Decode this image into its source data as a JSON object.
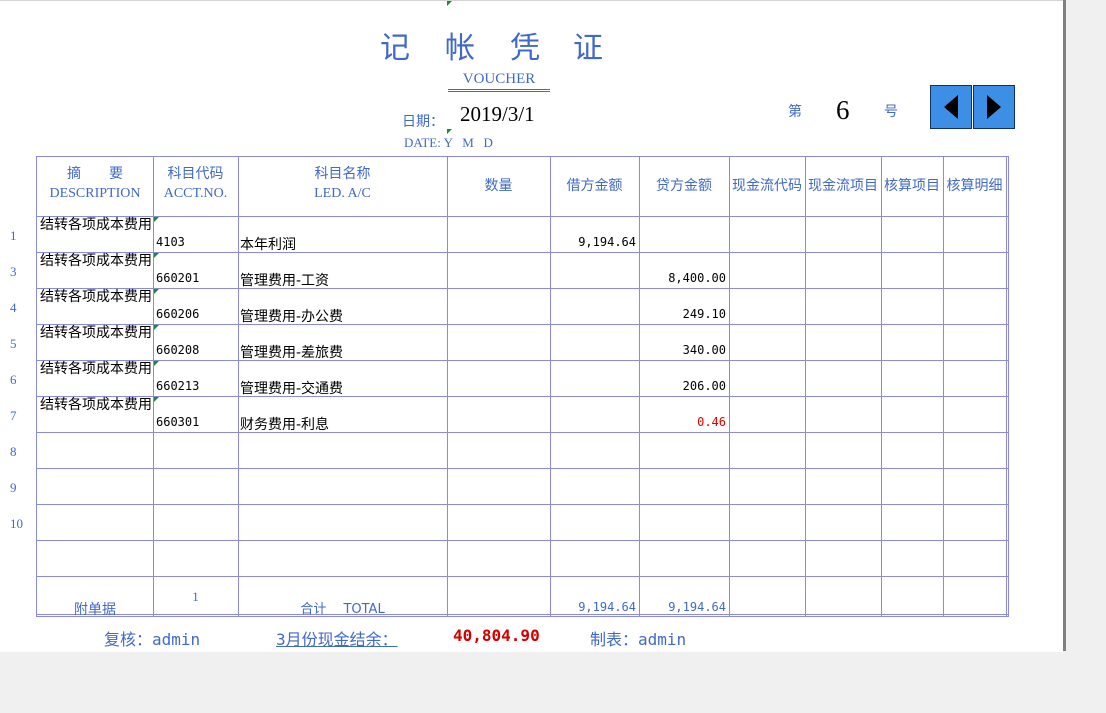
{
  "title_chars": [
    "记",
    "帐",
    "凭",
    "证"
  ],
  "subtitle": "VOUCHER",
  "date": {
    "label": "日期：",
    "value": "2019/3/1",
    "sub": "DATE: Y   M   D"
  },
  "voucher_no": {
    "prefix": "第",
    "value": "6",
    "suffix": "号"
  },
  "nav": {
    "prev_icon": "triangle-left-icon",
    "next_icon": "triangle-right-icon"
  },
  "headers": {
    "desc_cn": "摘　　要",
    "desc_en": "DESCRIPTION",
    "acct_cn": "科目代码",
    "acct_en": "ACCT.NO.",
    "led_cn": "科目名称",
    "led_en": "LED. A/C",
    "qty": "数量",
    "debit": "借方金额",
    "credit": "贷方金额",
    "cf_code": "现金流代码",
    "cf_item": "现金流项目",
    "audit_item": "核算项目",
    "audit_detail": "核算明细"
  },
  "rows": [
    {
      "num": "1",
      "desc": "结转各项成本费用",
      "acct": "4103",
      "name": "本年利润",
      "debit": "9,194.64",
      "credit": ""
    },
    {
      "num": "3",
      "desc": "结转各项成本费用",
      "acct": "660201",
      "name": "管理费用-工资",
      "debit": "",
      "credit": "8,400.00"
    },
    {
      "num": "4",
      "desc": "结转各项成本费用",
      "acct": "660206",
      "name": "管理费用-办公费",
      "debit": "",
      "credit": "249.10"
    },
    {
      "num": "5",
      "desc": "结转各项成本费用",
      "acct": "660208",
      "name": "管理费用-差旅费",
      "debit": "",
      "credit": "340.00"
    },
    {
      "num": "6",
      "desc": "结转各项成本费用",
      "acct": "660213",
      "name": "管理费用-交通费",
      "debit": "",
      "credit": "206.00"
    },
    {
      "num": "7",
      "desc": "结转各项成本费用",
      "acct": "660301",
      "name": "财务费用-利息",
      "debit": "",
      "credit": "0.46"
    },
    {
      "num": "8"
    },
    {
      "num": "9"
    },
    {
      "num": "10"
    },
    {
      "num": ""
    }
  ],
  "total_row": {
    "attach_label": "附单据",
    "attach_count": "1",
    "total_label": "合计　 TOTAL",
    "debit_total": "9,194.64",
    "credit_total": "9,194.64"
  },
  "footer": {
    "reviewer": "复核：admin",
    "cash_label": "3月份现金结余：",
    "cash_value": "40,804.90",
    "maker": "制表：admin"
  },
  "colors": {
    "accent_blue": "#4169c8",
    "grid": "#8a8ae0",
    "nav_button": "#3d8fe6",
    "negative_red": "#e00000",
    "cash_red": "#d40000"
  }
}
